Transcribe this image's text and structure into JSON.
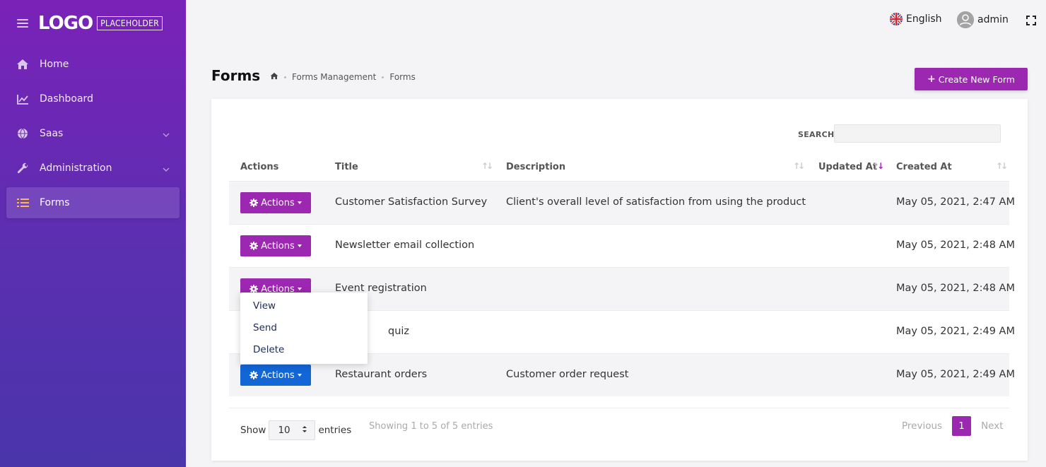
{
  "sidebar": {
    "logo_main": "LOGO",
    "logo_sub": "PLACEHOLDER",
    "items": [
      {
        "label": "Home",
        "icon": "home-icon"
      },
      {
        "label": "Dashboard",
        "icon": "chart-icon"
      },
      {
        "label": "Saas",
        "icon": "globe-icon",
        "has_submenu": true
      },
      {
        "label": "Administration",
        "icon": "wrench-icon",
        "has_submenu": true
      },
      {
        "label": "Forms",
        "icon": "list-icon",
        "active": true
      }
    ]
  },
  "topbar": {
    "language": "English",
    "user": "admin"
  },
  "header": {
    "title": "Forms",
    "breadcrumb": [
      "Forms Management",
      "Forms"
    ],
    "create_button": "Create New Form"
  },
  "table": {
    "search_label": "SEARCH",
    "search_value": "",
    "columns": [
      "Actions",
      "Title",
      "Description",
      "Updated At",
      "Created At"
    ],
    "action_label": "Actions",
    "rows": [
      {
        "title": "Customer Satisfaction Survey",
        "description": "Client's overall level of satisfaction from using the product",
        "updated_at": "",
        "created_at": "May 05, 2021, 2:47 AM"
      },
      {
        "title": "Newsletter email collection",
        "description": "",
        "updated_at": "",
        "created_at": "May 05, 2021, 2:48 AM"
      },
      {
        "title": "Event registration",
        "description": "",
        "updated_at": "",
        "created_at": "May 05, 2021, 2:48 AM"
      },
      {
        "title": "quiz",
        "description": "",
        "updated_at": "",
        "created_at": "May 05, 2021, 2:49 AM"
      },
      {
        "title": "Restaurant orders",
        "description": "Customer order request",
        "updated_at": "",
        "created_at": "May 05, 2021, 2:49 AM"
      }
    ],
    "dropdown_items": [
      "View",
      "Send",
      "Delete"
    ]
  },
  "footer": {
    "show_label": "Show",
    "entries_value": "10",
    "entries_label": "entries",
    "info": "Showing 1 to 5 of 5 entries",
    "prev": "Previous",
    "page": "1",
    "next": "Next"
  },
  "colors": {
    "accent": "#9c27b0",
    "primary_blue": "#1266d6",
    "sidebar_top": "#7a22b8",
    "sidebar_bottom": "#4a35ab"
  }
}
